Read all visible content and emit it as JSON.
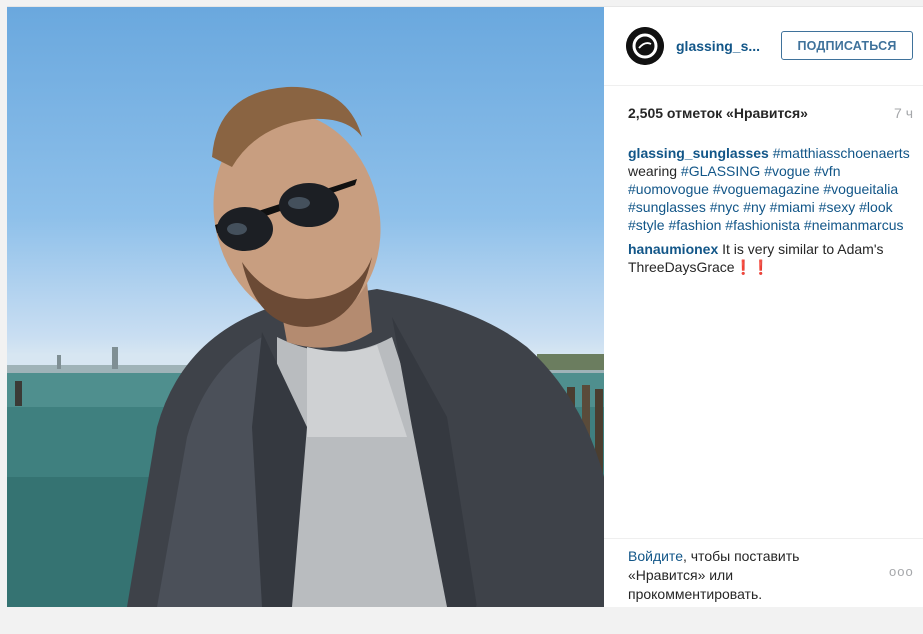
{
  "account": {
    "username": "glassing_s...",
    "follow_label": "ПОДПИСАТЬСЯ"
  },
  "post": {
    "likes": "2,505 отметок «Нравится»",
    "time": "7 ч",
    "caption": {
      "author": "glassing_sunglasses",
      "tag1": "#matthiasschoenaerts",
      "word": " wearing ",
      "tag2": "#GLASSING",
      "tag3": "#vogue",
      "tag4": "#vfn",
      "tag5": "#uomovogue",
      "tag6": "#voguemagazine",
      "tag7": "#vogueitalia",
      "tag8": "#sunglasses",
      "tag9": "#nyc",
      "tag10": "#ny",
      "tag11": "#miami",
      "tag12": "#sexy",
      "tag13": "#look",
      "tag14": "#style",
      "tag15": "#fashion",
      "tag16": "#fashionista",
      "tag17": "#neimanmarcus"
    },
    "comment": {
      "author": "hanaumionex",
      "text": " It is very similar to Adam's ThreeDaysGrace❗❗"
    }
  },
  "footer": {
    "login_link": "Войдите",
    "login_rest": ", чтобы поставить «Нравится» или прокомментировать.",
    "more_label": "ooo"
  },
  "colors": {
    "link": "#125688",
    "button": "#3f729b",
    "muted": "#a5a7aa"
  },
  "icons": {
    "avatar": "glassing-logo-icon",
    "more": "more-options-icon"
  }
}
